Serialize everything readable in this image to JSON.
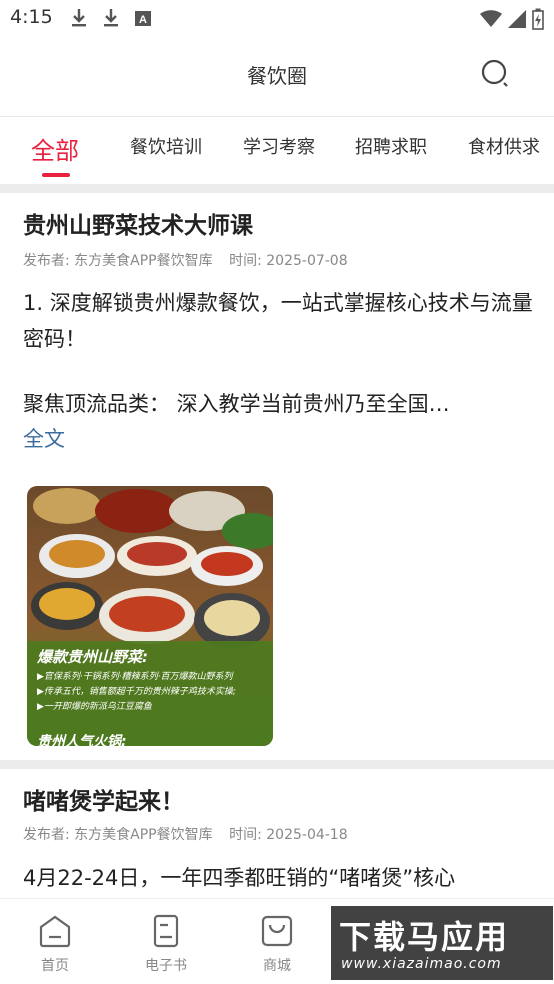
{
  "status_bar": {
    "time": "4:15"
  },
  "header": {
    "title": "餐饮圈"
  },
  "tabs": [
    {
      "label": "全部",
      "active": true
    },
    {
      "label": "餐饮培训"
    },
    {
      "label": "学习考察"
    },
    {
      "label": "招聘求职"
    },
    {
      "label": "食材供求"
    }
  ],
  "posts": [
    {
      "title": "贵州山野菜技术大师课",
      "publisher_label": "发布者: 东方美食APP餐饮智库",
      "time_label": "时间: 2025-07-08",
      "body_line1": "1. 深度解锁贵州爆款餐饮，一站式掌握核心技术与流量密码！",
      "body_line2": "聚焦顶流品类： 深入教学当前贵州乃至全国…",
      "more_link": "全文",
      "image": {
        "caption": "爆款贵州山野菜:",
        "items": [
          "▶官保系列·干锅系列·糟辣系列·百万爆款山野系列",
          "▶传承五代，销售额超千万的贵州辣子鸡技术实操;",
          "▶一开即爆的新派乌江豆腐鱼"
        ],
        "caption2": "贵州人气火锅:"
      }
    },
    {
      "title": "啫啫煲学起来！",
      "publisher_label": "发布者: 东方美食APP餐饮智库",
      "time_label": "时间: 2025-04-18",
      "body_line1": "4月22-24日，一年四季都旺销的“啫啫煲”核心"
    }
  ],
  "bottom_nav": [
    {
      "label": "首页",
      "icon": "home-icon"
    },
    {
      "label": "电子书",
      "icon": "ebook-icon"
    },
    {
      "label": "商城",
      "icon": "shop-bag-icon"
    }
  ],
  "watermark": {
    "text": "下载马应用",
    "url": "www.xiazaimao.com"
  },
  "colors": {
    "accent": "#e8213f",
    "link": "#3c6b9e"
  }
}
